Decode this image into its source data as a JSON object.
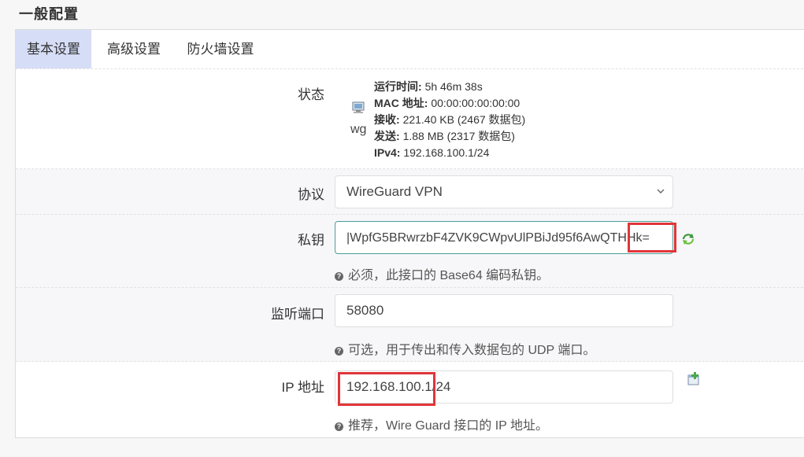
{
  "section_title": "一般配置",
  "tabs": [
    {
      "label": "基本设置",
      "active": true
    },
    {
      "label": "高级设置",
      "active": false
    },
    {
      "label": "防火墙设置",
      "active": false
    }
  ],
  "status": {
    "label": "状态",
    "icon": "network-interface-icon",
    "interface_name": "wg",
    "uptime_key": "运行时间:",
    "uptime_value": "5h 46m 38s",
    "mac_key": "MAC 地址:",
    "mac_value": "00:00:00:00:00:00",
    "rx_key": "接收:",
    "rx_value": "221.40 KB (2467 数据包)",
    "tx_key": "发送:",
    "tx_value": "1.88 MB (2317 数据包)",
    "ipv4_key": "IPv4:",
    "ipv4_value": "192.168.100.1/24"
  },
  "protocol": {
    "label": "协议",
    "value": "WireGuard VPN"
  },
  "private_key": {
    "label": "私钥",
    "value": "|WpfG5BRwrzbF4ZVK9CWpvUlPBiJd95f6AwQTHHk=",
    "hint": "必须，此接口的 Base64 编码私钥。",
    "icon": "refresh-generate-icon"
  },
  "listen_port": {
    "label": "监听端口",
    "value": "58080",
    "hint": "可选，用于传出和传入数据包的 UDP 端口。"
  },
  "ip_address": {
    "label": "IP 地址",
    "value": "192.168.100.1/24",
    "hint": "推荐，Wire Guard 接口的 IP 地址。",
    "icon": "add-field-icon"
  },
  "colors": {
    "tab_active": "#d6ddf7",
    "focus_border": "#4a9d96",
    "highlight": "#e0353a"
  }
}
